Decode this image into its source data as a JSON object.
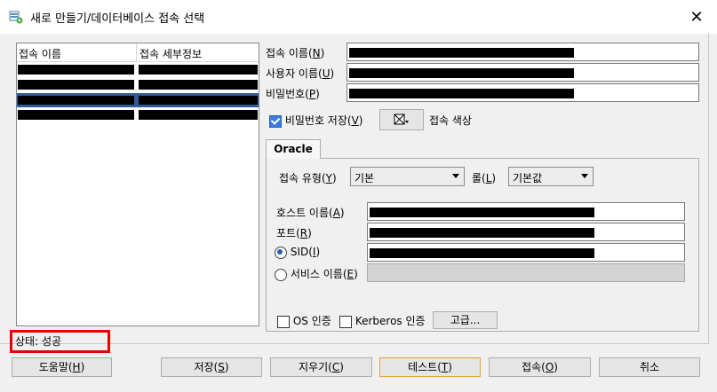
{
  "window": {
    "title": "새로 만들기/데이터베이스 접속 선택"
  },
  "connection_list": {
    "columns": [
      "접속 이름",
      "접속 세부정보"
    ],
    "rows": [
      {
        "selected": false
      },
      {
        "selected": false
      },
      {
        "selected": true
      },
      {
        "selected": false
      }
    ]
  },
  "form": {
    "connection_name_label": "접속 이름(",
    "connection_name_key": "N",
    "user_name_label": "사용자 이름(",
    "user_name_key": "U",
    "password_label": "비밀번호(",
    "password_key": "P",
    "save_password_label": "비밀번호 저장(",
    "save_password_key": "V",
    "save_password_checked": true,
    "connection_color_label": "접속 색상"
  },
  "tab": {
    "label": "Oracle"
  },
  "oracle": {
    "connection_type_label": "접속 유형(",
    "connection_type_key": "Y",
    "connection_type_value": "기본",
    "role_label": "롤(",
    "role_key": "L",
    "role_value": "기본값",
    "hostname_label": "호스트 이름(",
    "hostname_key": "A",
    "port_label": "포트(",
    "port_key": "R",
    "sid_label": "SID(",
    "sid_key": "I",
    "service_name_label": "서비스 이름(",
    "service_name_key": "E",
    "sid_selected": true,
    "os_auth_label": "OS 인증",
    "kerberos_label": "Kerberos 인증",
    "advanced_label": "고급..."
  },
  "status": {
    "text": "상태: 성공"
  },
  "buttons": {
    "help": "도움말(",
    "help_key": "H",
    "save": "저장(",
    "save_key": "S",
    "clear": "지우기(",
    "clear_key": "C",
    "test": "테스트(",
    "test_key": "T",
    "connect": "접속(",
    "connect_key": "O",
    "cancel": "취소"
  },
  "colors": {
    "status_highlight": "#e60000",
    "selection": "#2f5d9a",
    "accent": "#3d7bd8"
  }
}
